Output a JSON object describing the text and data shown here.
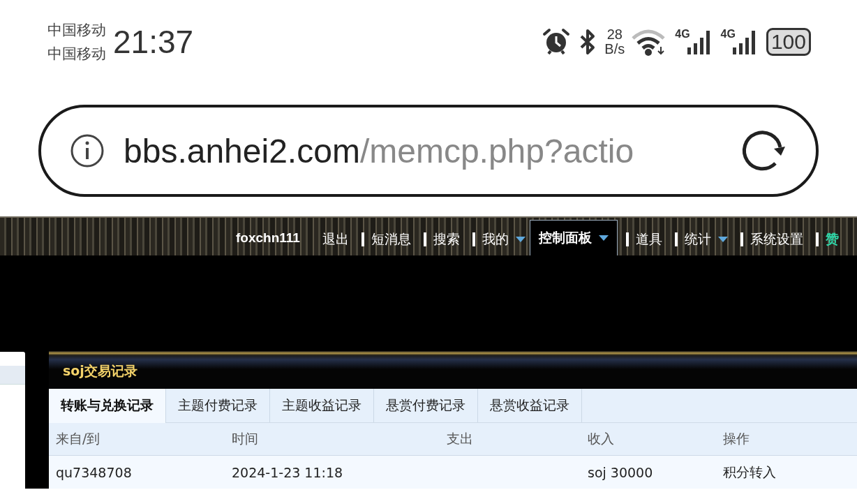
{
  "status_bar": {
    "carriers": [
      "中国移动",
      "中国移动"
    ],
    "time": "21:37",
    "speed_value": "28",
    "speed_unit": "B/s",
    "network_labels": [
      "4G",
      "4G"
    ],
    "battery": "100"
  },
  "address_bar": {
    "domain": "bbs.anhei2.com",
    "path": "/memcp.php?actio"
  },
  "nav": {
    "username": "foxchn111",
    "items": [
      {
        "label": "退出",
        "selected": false,
        "dropdown": false,
        "separator": false
      },
      {
        "label": "短消息",
        "selected": false,
        "dropdown": false,
        "separator": true
      },
      {
        "label": "搜索",
        "selected": false,
        "dropdown": false,
        "separator": true
      },
      {
        "label": "我的",
        "selected": false,
        "dropdown": true,
        "separator": true
      },
      {
        "label": "控制面板",
        "selected": true,
        "dropdown": true,
        "separator": false
      },
      {
        "label": "道具",
        "selected": false,
        "dropdown": false,
        "separator": true
      },
      {
        "label": "统计",
        "selected": false,
        "dropdown": true,
        "separator": true
      },
      {
        "label": "系统设置",
        "selected": false,
        "dropdown": false,
        "separator": true
      },
      {
        "label": "赞",
        "selected": false,
        "dropdown": false,
        "separator": true
      }
    ]
  },
  "panel": {
    "title": "soj交易记录",
    "tabs": [
      {
        "label": "转账与兑换记录",
        "selected": true
      },
      {
        "label": "主题付费记录",
        "selected": false
      },
      {
        "label": "主题收益记录",
        "selected": false
      },
      {
        "label": "悬赏付费记录",
        "selected": false
      },
      {
        "label": "悬赏收益记录",
        "selected": false
      }
    ],
    "table": {
      "columns": [
        "来自/到",
        "时间",
        "支出",
        "收入",
        "操作"
      ],
      "rows": [
        [
          "qu7348708",
          "2024-1-23 11:18",
          "",
          "soj 30000",
          "积分转入"
        ]
      ]
    }
  }
}
